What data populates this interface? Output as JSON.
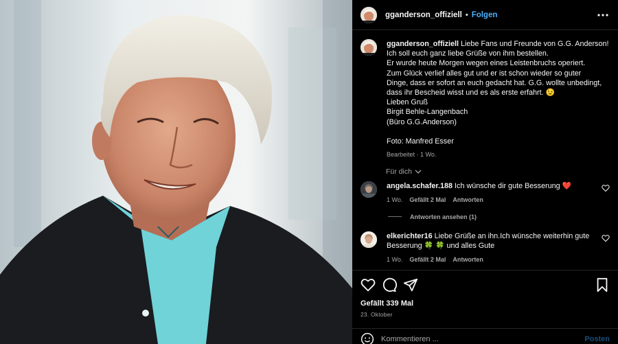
{
  "post": {
    "username": "gganderson_offiziell",
    "separator": "•",
    "follow_label": "Folgen",
    "more_icon": "more-horizontal-icon",
    "caption_lines": [
      "Liebe Fans und Freunde von G.G. Anderson!",
      "Ich soll euch ganz liebe Grüße von ihm bestellen.",
      "Er wurde heute Morgen wegen eines Leistenbruchs operiert.",
      "Zum Glück verlief alles gut und er ist schon wieder so guter",
      "Dinge, dass er sofort an euch gedacht hat. G.G. wollte unbedingt,",
      "dass ihr Bescheid wisst und es als erste erfahrt. 😉",
      "Lieben Gruß",
      "Birgit Behle-Langenbach",
      "(Büro G.G.Anderson)",
      "",
      "Foto: Manfred Esser"
    ],
    "caption_meta": "Bearbeitet · 1 Wo.",
    "for_you_label": "Für dich"
  },
  "comments": [
    {
      "username": "angela.schafer.188",
      "text": "Ich wünsche dir gute Besserung ❤️",
      "time": "1 Wo.",
      "likes": "Gefällt 2 Mal",
      "reply_label": "Antworten",
      "view_replies": "Antworten ansehen (1)"
    },
    {
      "username": "elkerichter16",
      "text": "Liebe Grüße an ihn.Ich wünsche weiterhin gute Besserung 🍀 🍀 und alles Gute",
      "time": "1 Wo.",
      "likes": "Gefällt 2 Mal",
      "reply_label": "Antworten"
    }
  ],
  "footer": {
    "likes_count": "Gefällt 339 Mal",
    "date": "23. Oktober",
    "comment_placeholder": "Kommentieren ...",
    "post_label": "Posten"
  },
  "colors": {
    "background": "#000000",
    "link": "#4bb0ff",
    "muted": "#a8a8a8",
    "heart": "#ff3040"
  }
}
